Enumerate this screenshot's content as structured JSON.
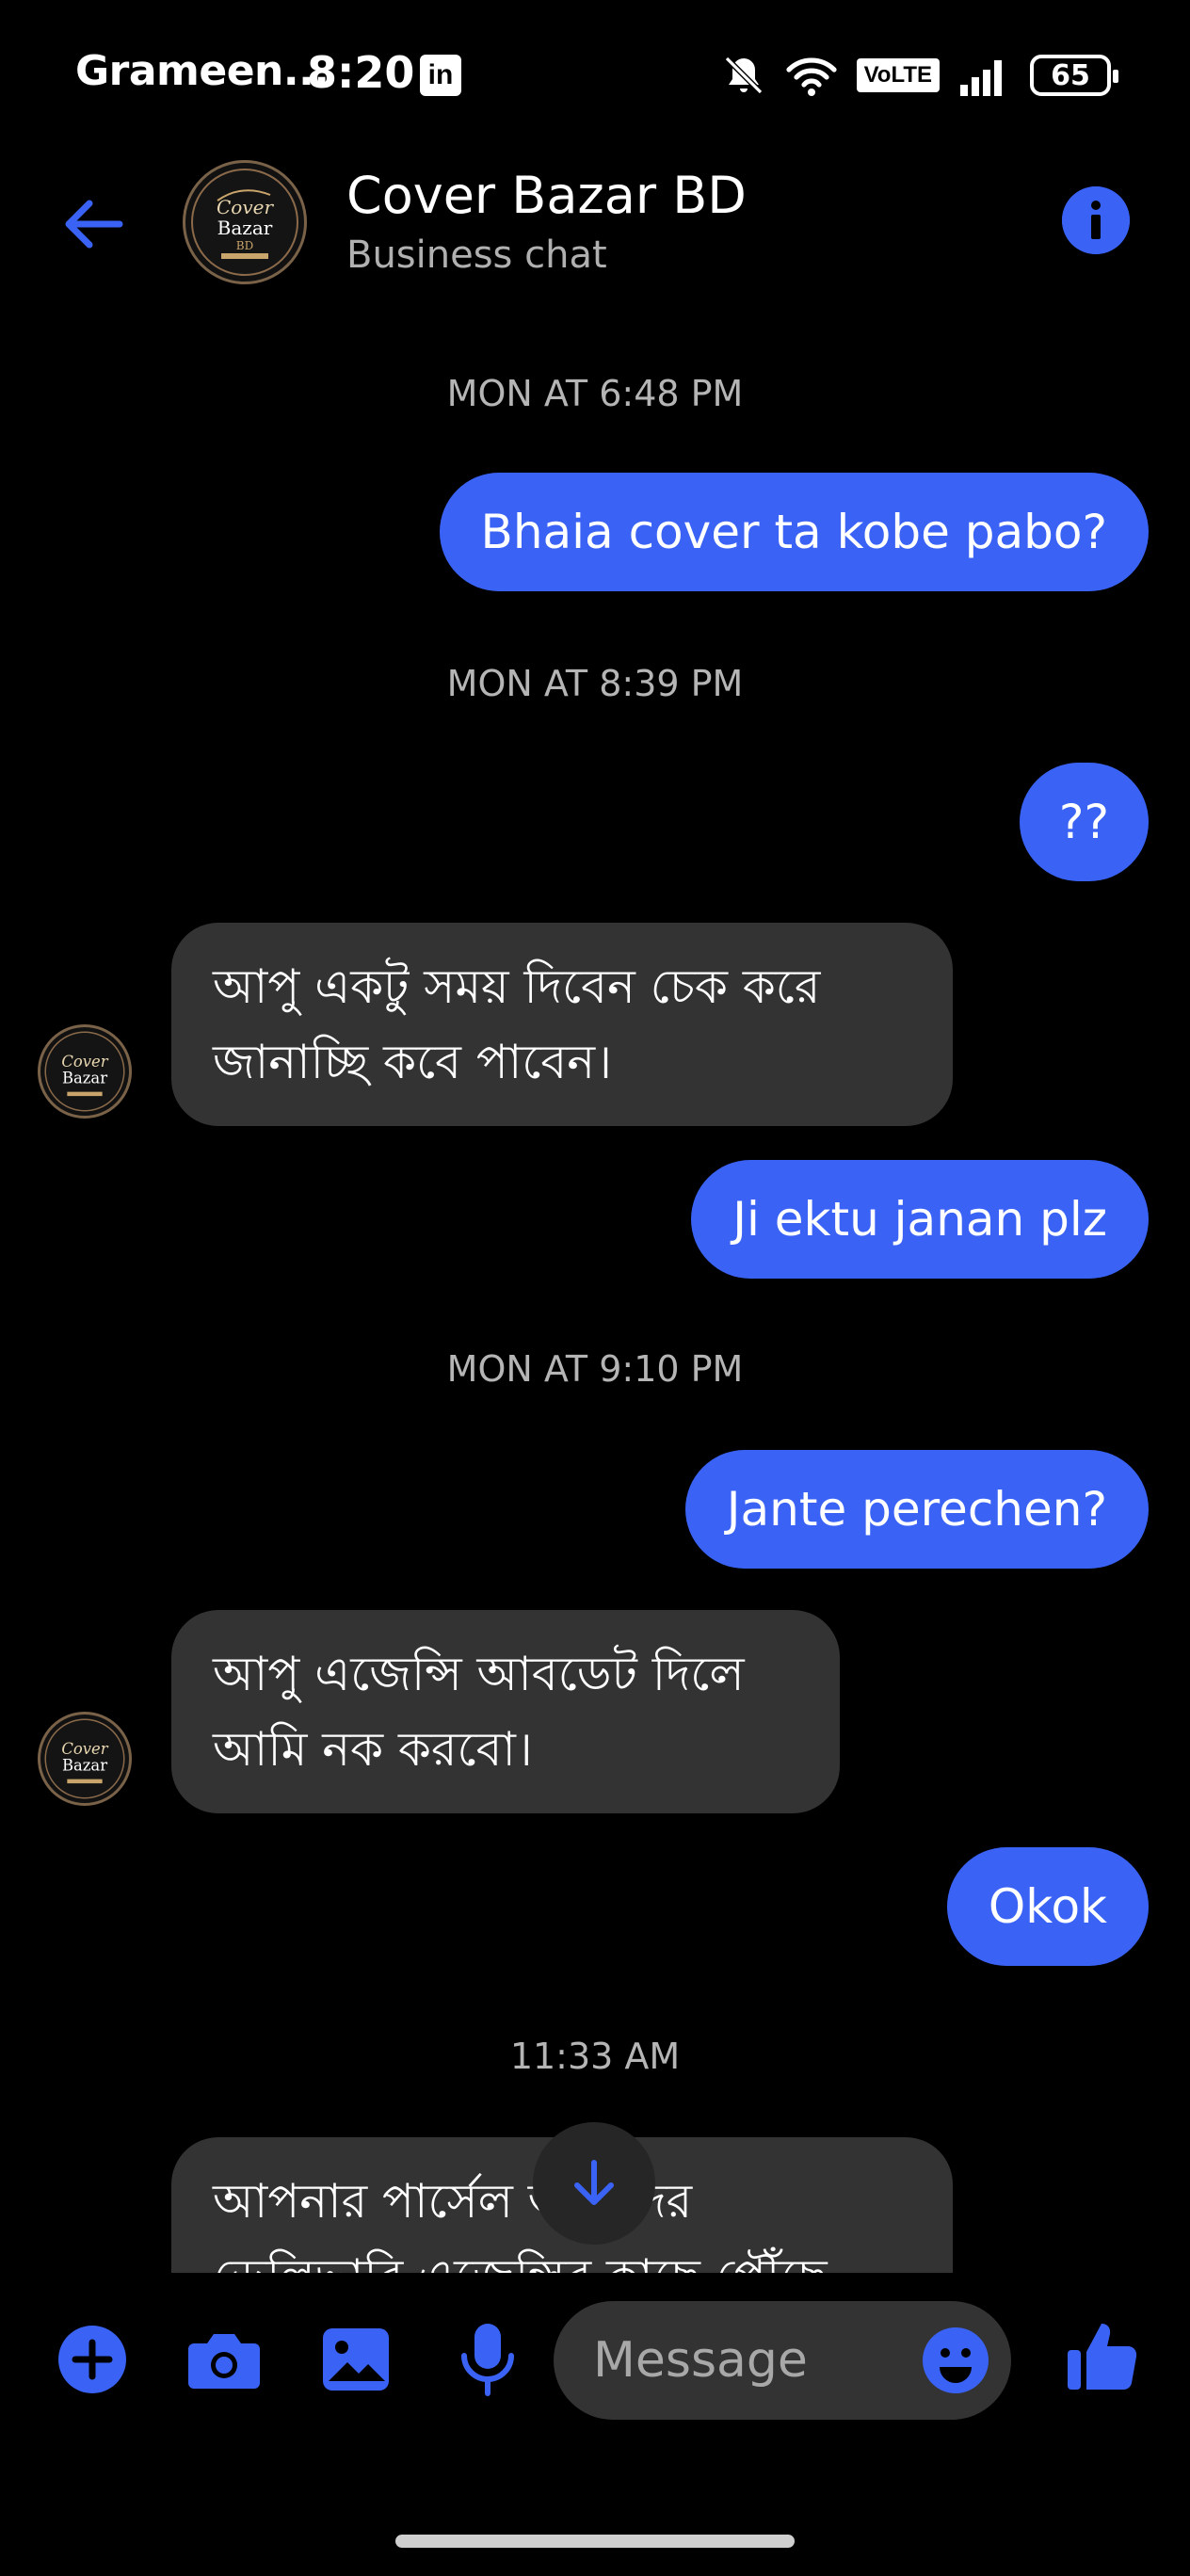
{
  "status_bar": {
    "carrier": "Grameen...",
    "time": "8:20",
    "linkedin_glyph": "in",
    "volte": "VoLTE",
    "battery": "65"
  },
  "header": {
    "name": "Cover Bazar BD",
    "subtitle": "Business chat",
    "logo_text_1": "Cover",
    "logo_text_2": "Bazar",
    "logo_text_3": "BD"
  },
  "messages": {
    "ts1": "MON AT 6:48 PM",
    "m1": "Bhaia cover ta kobe pabo?",
    "ts2": "MON AT 8:39 PM",
    "m2": "??",
    "m3_line1": "আপু একটু সময় দিবেন চেক করে",
    "m3_line2": "জানাচ্ছি কবে পাবেন।",
    "m4": "Ji ektu janan plz",
    "ts3": "MON AT 9:10 PM",
    "m5": "Jante perechen?",
    "m6_line1": "আপু এজেন্সি আবডেট দিলে",
    "m6_line2": "আমি নক করবো।",
    "m7": "Okok",
    "ts4": "11:33 AM",
    "m8_line1": "আপনার পার্সেল আমাদের",
    "m8_line2": "ডেলিভারি এজেন্সির কাছে পৌঁছে"
  },
  "composer": {
    "placeholder": "Message"
  },
  "icons": {
    "back": "arrow-left-icon",
    "info": "info-icon",
    "add": "plus-circle-icon",
    "camera": "camera-icon",
    "gallery": "image-icon",
    "mic": "microphone-icon",
    "emoji": "smiley-icon",
    "like": "thumbs-up-icon",
    "scroll": "arrow-down-icon"
  },
  "colors": {
    "accent": "#3a63f5",
    "incoming_bubble": "#333333",
    "background": "#000000"
  }
}
